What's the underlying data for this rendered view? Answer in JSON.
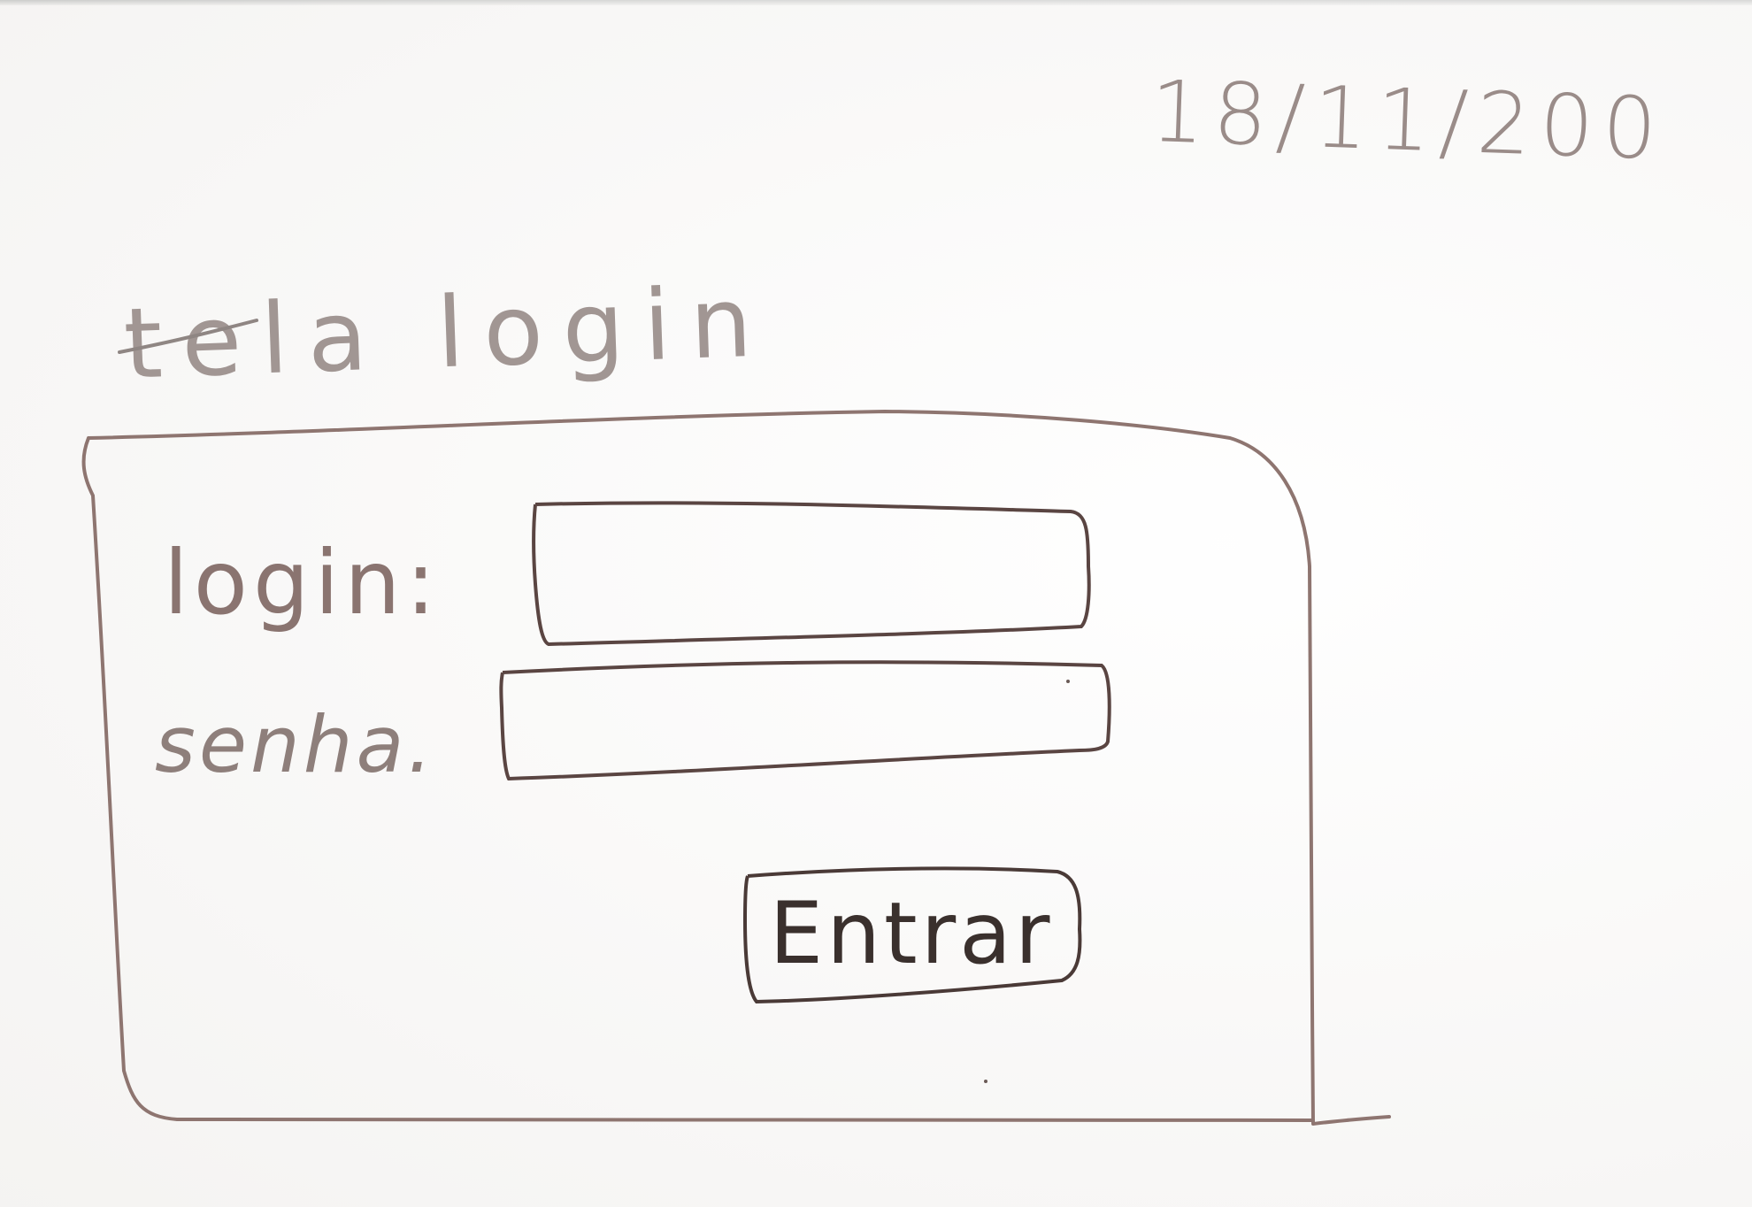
{
  "date": "18/11/200",
  "title": "tela login",
  "form": {
    "login_label": "login:",
    "password_label": "senha.",
    "login_value": "",
    "password_value": "",
    "submit_label": "Entrar"
  }
}
